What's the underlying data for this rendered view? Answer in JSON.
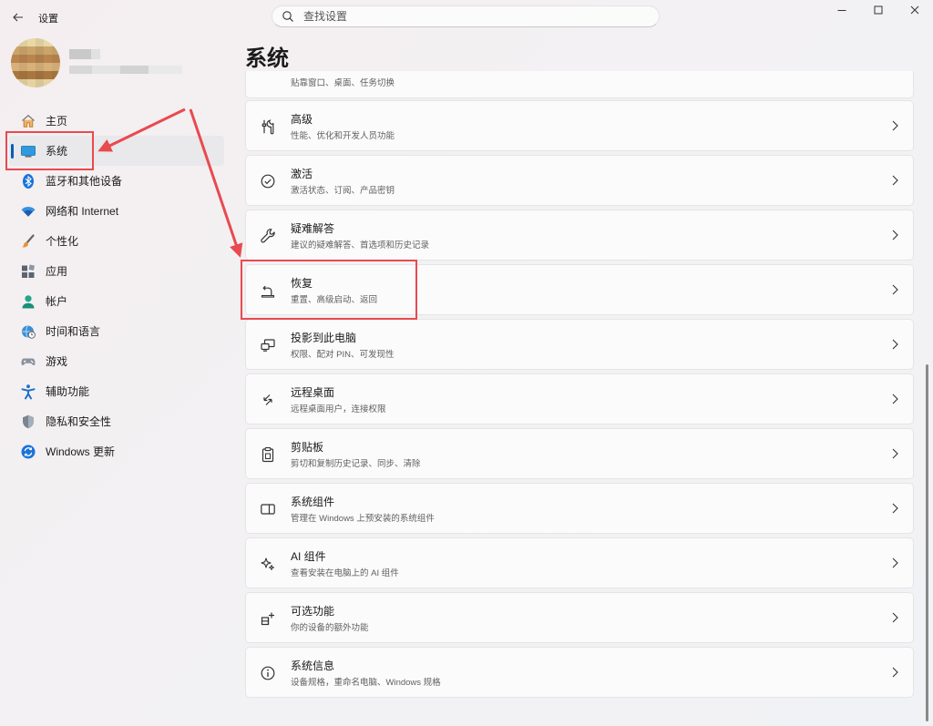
{
  "app": {
    "title": "设置"
  },
  "search": {
    "placeholder": "查找设置"
  },
  "page": {
    "title": "系统"
  },
  "sidebar": {
    "items": [
      {
        "label": "主页",
        "icon": "home-icon"
      },
      {
        "label": "系统",
        "icon": "system-display-icon",
        "active": true
      },
      {
        "label": "蓝牙和其他设备",
        "icon": "bluetooth-icon"
      },
      {
        "label": "网络和 Internet",
        "icon": "wifi-icon"
      },
      {
        "label": "个性化",
        "icon": "paintbrush-icon"
      },
      {
        "label": "应用",
        "icon": "apps-icon"
      },
      {
        "label": "帐户",
        "icon": "account-icon"
      },
      {
        "label": "时间和语言",
        "icon": "globe-clock-icon"
      },
      {
        "label": "游戏",
        "icon": "gamepad-icon"
      },
      {
        "label": "辅助功能",
        "icon": "accessibility-icon"
      },
      {
        "label": "隐私和安全性",
        "icon": "shield-icon"
      },
      {
        "label": "Windows 更新",
        "icon": "update-icon"
      }
    ]
  },
  "cards": [
    {
      "title": "",
      "sub": "贴靠窗口、桌面、任务切换",
      "icon": ""
    },
    {
      "title": "高级",
      "sub": "性能、优化和开发人员功能",
      "icon": "tools-icon"
    },
    {
      "title": "激活",
      "sub": "激活状态、订阅、产品密钥",
      "icon": "check-circle-icon"
    },
    {
      "title": "疑难解答",
      "sub": "建议的疑难解答、首选项和历史记录",
      "icon": "wrench-icon"
    },
    {
      "title": "恢复",
      "sub": "重置、高级启动、返回",
      "icon": "recovery-icon"
    },
    {
      "title": "投影到此电脑",
      "sub": "权限、配对 PIN、可发现性",
      "icon": "project-icon"
    },
    {
      "title": "远程桌面",
      "sub": "远程桌面用户，连接权限",
      "icon": "remote-desktop-icon"
    },
    {
      "title": "剪贴板",
      "sub": "剪切和复制历史记录、同步、清除",
      "icon": "clipboard-icon"
    },
    {
      "title": "系统组件",
      "sub": "管理在 Windows 上预安装的系统组件",
      "icon": "system-components-icon"
    },
    {
      "title": "AI 组件",
      "sub": "查看安装在电脑上的 AI 组件",
      "icon": "sparkle-icon"
    },
    {
      "title": "可选功能",
      "sub": "你的设备的额外功能",
      "icon": "optional-features-icon"
    },
    {
      "title": "系统信息",
      "sub": "设备规格，重命名电脑、Windows 规格",
      "icon": "info-icon"
    }
  ],
  "colors": {
    "accent": "#005fb8",
    "annotation": "#e84a4f"
  }
}
